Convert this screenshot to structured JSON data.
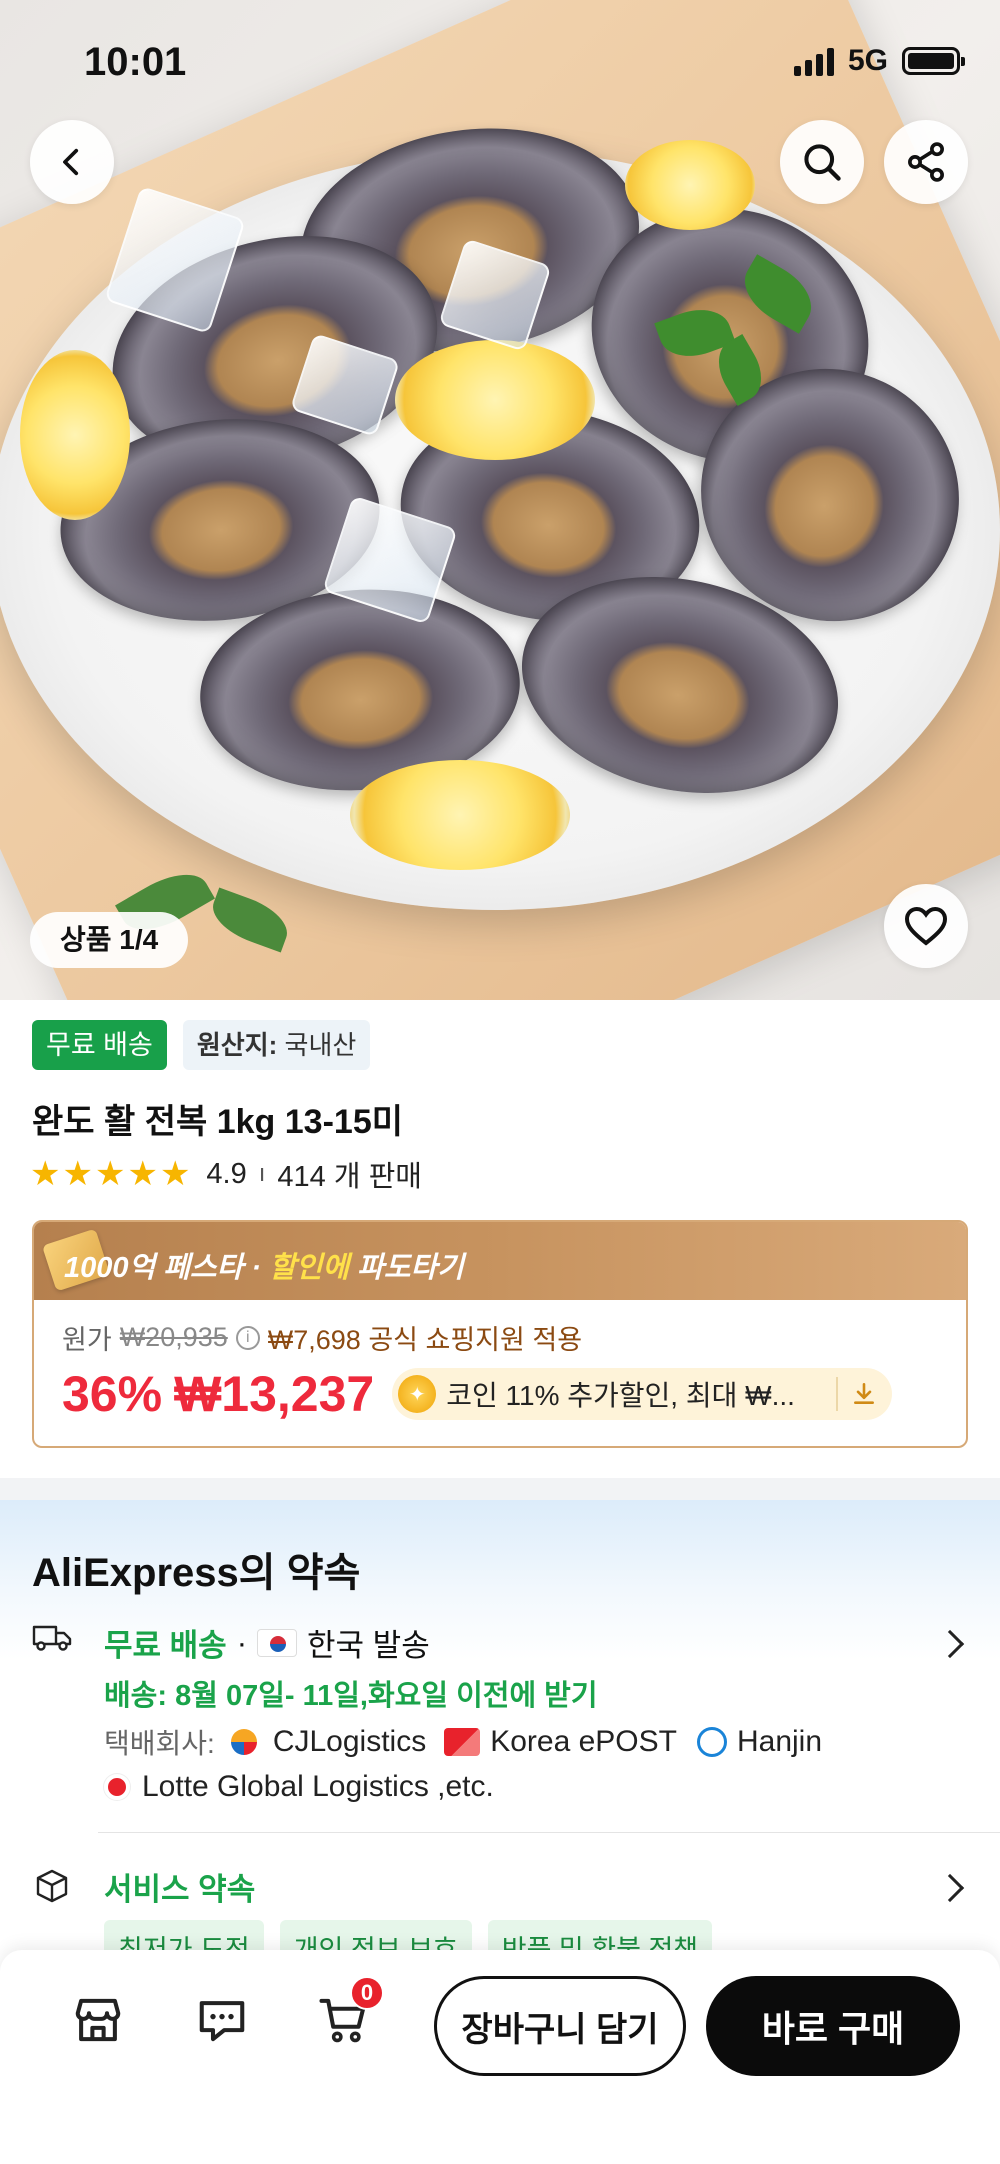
{
  "status_bar": {
    "time": "10:01",
    "network": "5G"
  },
  "gallery": {
    "counter": "상품 1/4"
  },
  "tags": {
    "free_shipping": "무료 배송",
    "origin_label": "원산지:",
    "origin_value": "국내산"
  },
  "product": {
    "title": "완도 활 전복 1kg 13-15미",
    "rating": "4.9",
    "rating_separator": "ı",
    "sold": "414 개 판매"
  },
  "promo": {
    "title_prefix": "1000억 페스타 · ",
    "title_highlight": "할인에",
    "title_suffix": " 파도타기",
    "original_label": "원가",
    "original_price": "₩20,935",
    "info_icon": "i",
    "subsidy": "₩7,698 공식 쇼핑지원 적용",
    "discount": "36%",
    "price": "₩13,237",
    "coin_text": "코인 11% 추가할인, 최대 ₩..."
  },
  "promise": {
    "title": "AliExpress의 약속",
    "shipping_label": "무료 배송",
    "shipping_sep": "·",
    "shipping_from": "한국 발송",
    "delivery": "배송: 8월 07일- 11일,화요일 이전에 받기",
    "carrier_label": "택배회사:",
    "carriers": [
      "CJLogistics",
      "Korea ePOST",
      "Hanjin"
    ],
    "carrier_more": "Lotte Global Logistics ,etc.",
    "service_title": "서비스 약속",
    "service_chips": [
      "최저가 도전",
      "개인 정보 보호",
      "반품 및 환불 정책"
    ]
  },
  "bottom_bar": {
    "cart_count": "0",
    "add_to_cart": "장바구니 담기",
    "buy_now": "바로 구매"
  },
  "colors": {
    "price_red": "#ee2a3c",
    "free_green": "#18a04a",
    "promo_gold": "#c7935f",
    "buy_black": "#0b0b0b"
  },
  "icons": [
    "back-icon",
    "search-icon",
    "share-icon",
    "heart-icon",
    "truck-icon",
    "chevron-right-icon",
    "box-icon",
    "store-icon",
    "chat-icon",
    "cart-icon",
    "download-icon",
    "coin-icon",
    "star-icon"
  ]
}
